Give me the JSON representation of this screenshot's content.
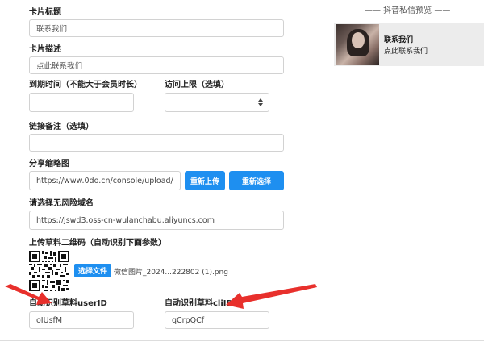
{
  "preview": {
    "title": "—— 抖音私信预览 ——",
    "card_title": "联系我们",
    "card_desc": "点此联系我们"
  },
  "form": {
    "card_title_label": "卡片标题",
    "card_title_value": "联系我们",
    "card_desc_label": "卡片描述",
    "card_desc_value": "点此联系我们",
    "expire_label": "到期时间（不能大于会员时长）",
    "visit_limit_label": "访问上限（选填）",
    "link_note_label": "链接备注（选填）",
    "share_img_label": "分享缩略图",
    "share_img_value": "https://www.0do.cn/console/upload/",
    "reupload_label": "重新上传",
    "reselect_label": "重新选择",
    "domain_label": "请选择无风险域名",
    "domain_value": "https://jswd3.oss-cn-wulanchabu.aliyuncs.com",
    "qr_label": "上传草料二维码（自动识别下面参数）",
    "choose_file_label": "选择文件",
    "file_name": "微信图片_2024...222802 (1).png",
    "user_id_label": "自动识别草料userID",
    "user_id_value": "oIUsfM",
    "cli_id_label": "自动识别草料cliID",
    "cli_id_value": "qCrpQCf"
  },
  "colors": {
    "accent": "#1e8ff0",
    "arrow": "#e8302c"
  }
}
